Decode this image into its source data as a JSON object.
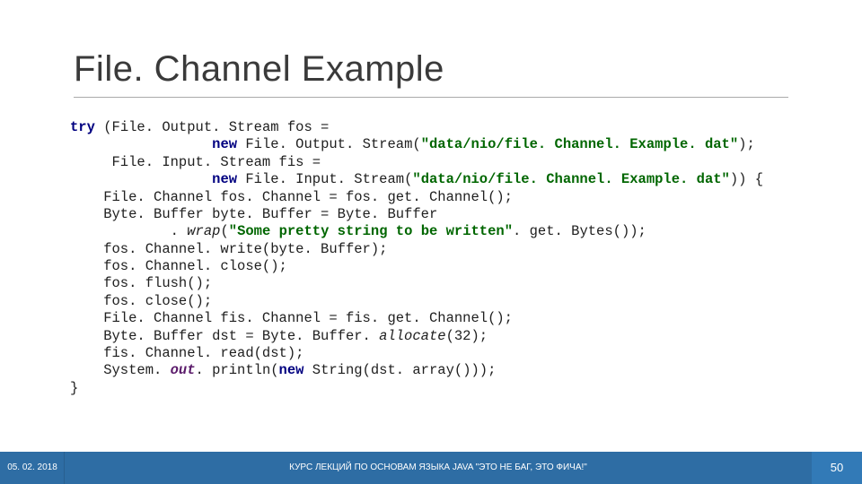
{
  "title": "File. Channel Example",
  "code": {
    "l1a": "try ",
    "l1b": "(File. Output. Stream fos =",
    "l2a": "                 ",
    "l2kw": "new ",
    "l2b": "File. Output. Stream(",
    "l2str": "\"data/nio/file. Channel. Example. dat\"",
    "l2c": ");",
    "l3": "     File. Input. Stream fis =",
    "l4a": "                 ",
    "l4kw": "new ",
    "l4b": "File. Input. Stream(",
    "l4str": "\"data/nio/file. Channel. Example. dat\"",
    "l4c": ")) {",
    "l5": "    File. Channel fos. Channel = fos. get. Channel();",
    "l6": "    Byte. Buffer byte. Buffer = Byte. Buffer",
    "l7a": "            . ",
    "l7m": "wrap",
    "l7b": "(",
    "l7str": "\"Some pretty string to be written\"",
    "l7c": ". get. Bytes());",
    "l8": "    fos. Channel. write(byte. Buffer);",
    "l9": "    fos. Channel. close();",
    "l10": "    fos. flush();",
    "l11": "    fos. close();",
    "l12": "    File. Channel fis. Channel = fis. get. Channel();",
    "l13a": "    Byte. Buffer dst = Byte. Buffer. ",
    "l13m": "allocate",
    "l13b": "(32);",
    "l14": "    fis. Channel. read(dst);",
    "l15a": "    System. ",
    "l15f": "out",
    "l15b": ". println(",
    "l15kw": "new ",
    "l15c": "String(dst. array()));",
    "l16": "}"
  },
  "footer": {
    "date": "05. 02. 2018",
    "center": "КУРС ЛЕКЦИЙ ПО ОСНОВАМ ЯЗЫКА JAVA \"ЭТО НЕ БАГ, ЭТО ФИЧА!\"",
    "page": "50"
  },
  "colors": {
    "footer_a": "#2e6da4",
    "footer_b": "#327ab7"
  }
}
